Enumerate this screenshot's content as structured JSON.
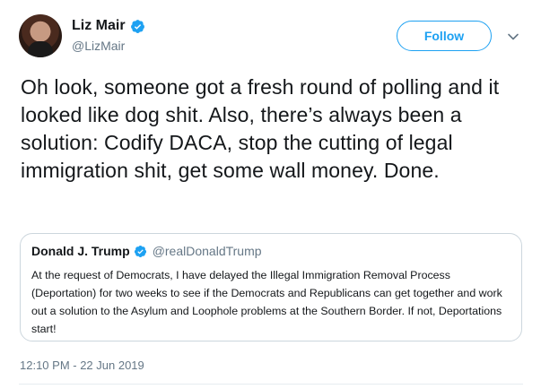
{
  "author": {
    "display_name": "Liz Mair",
    "handle": "@LizMair",
    "verified": true
  },
  "actions": {
    "follow_label": "Follow",
    "more_icon": "chevron-down-icon"
  },
  "tweet": {
    "text": "Oh look, someone got a fresh round of polling and it looked like dog shit. Also, there’s always been a solution: Codify DACA, stop the cutting of legal immigration shit, get some wall money. Done.",
    "timestamp": "12:10 PM - 22 Jun 2019"
  },
  "quoted_tweet": {
    "display_name": "Donald J. Trump",
    "handle": "@realDonaldTrump",
    "verified": true,
    "text": "At the request of Democrats, I have delayed the Illegal Immigration Removal Process (Deportation) for two weeks to see if the Democrats and Republicans can get together and work out a solution to the Asylum and Loophole problems at the Southern Border. If not, Deportations start!"
  },
  "colors": {
    "accent": "#1da1f2",
    "text_primary": "#14171a",
    "text_secondary": "#657786",
    "border": "#ccd6dd"
  }
}
